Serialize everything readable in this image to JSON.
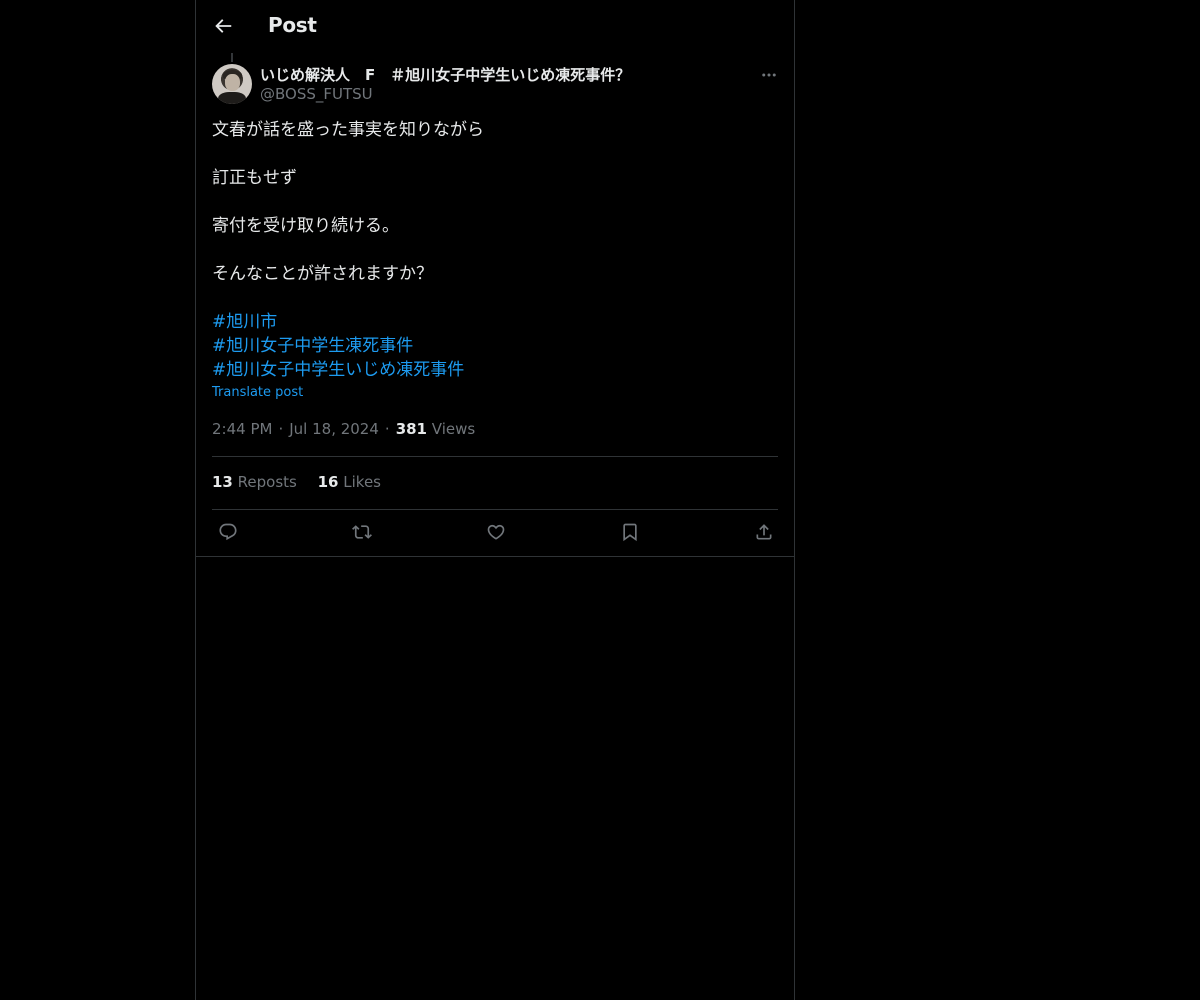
{
  "header": {
    "title": "Post"
  },
  "author": {
    "display_name": "いじめ解決人　F　＃旭川女子中学生いじめ凍死事件？",
    "handle": "@BOSS_FUTSU"
  },
  "post": {
    "lines": [
      "文春が話を盛った事実を知りながら",
      "訂正もせず",
      "寄付を受け取り続ける。",
      "そんなことが許されますか？"
    ],
    "hashtags": [
      "#旭川市",
      "#旭川女子中学生凍死事件",
      "#旭川女子中学生いじめ凍死事件"
    ],
    "translate_label": "Translate post"
  },
  "meta": {
    "time": "2:44 PM",
    "date": "Jul 18, 2024",
    "views_count": "381",
    "views_label": "Views"
  },
  "stats": {
    "reposts_count": "13",
    "reposts_label": "Reposts",
    "likes_count": "16",
    "likes_label": "Likes"
  },
  "icons": {
    "back": "arrow-left-icon",
    "more": "more-horizontal-icon",
    "reply": "reply-icon",
    "repost": "repost-icon",
    "like": "heart-icon",
    "bookmark": "bookmark-icon",
    "share": "share-icon"
  },
  "colors": {
    "background": "#000000",
    "text": "#e7e9ea",
    "secondary": "#71767b",
    "accent": "#1d9bf0",
    "border": "#2f3336"
  }
}
